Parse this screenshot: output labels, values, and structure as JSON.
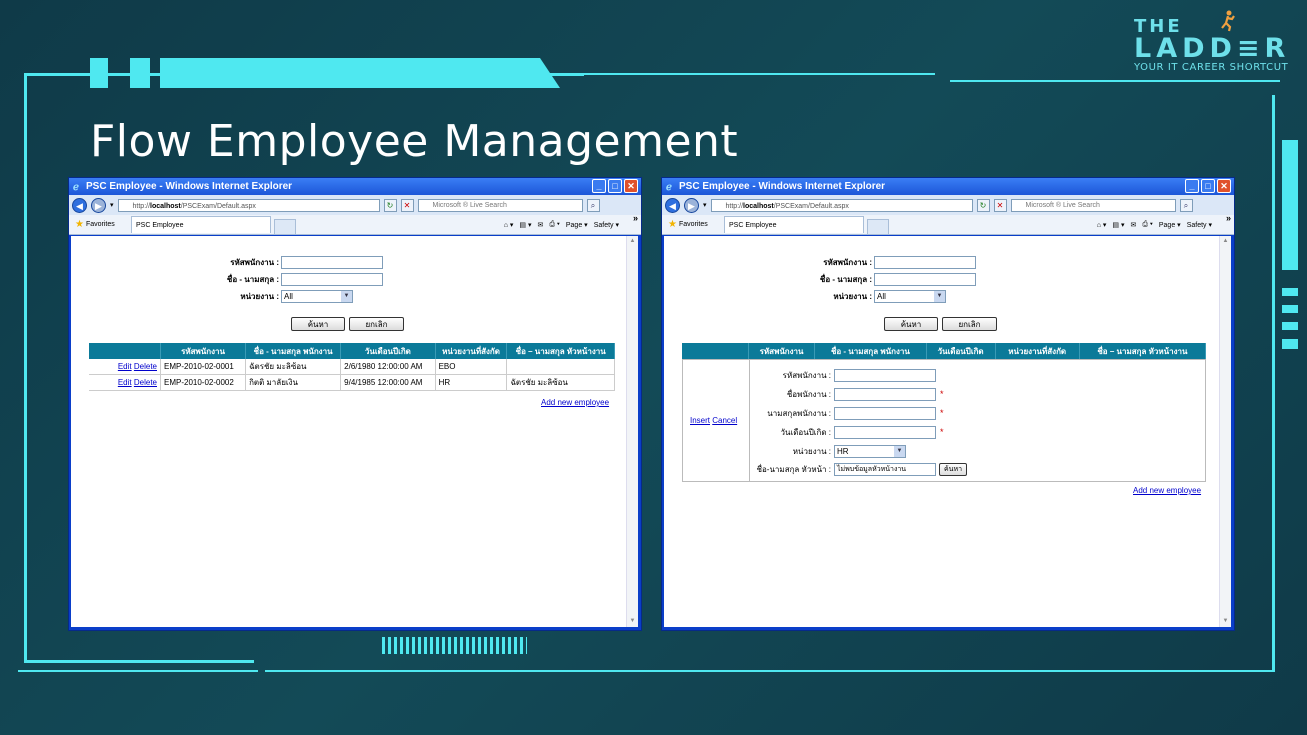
{
  "slide": {
    "title": "Flow Employee Management",
    "logo": {
      "the": "THE",
      "ladder": "LADD≡R",
      "tagline": "YOUR IT CAREER SHORTCUT"
    }
  },
  "browser": {
    "window_title": "PSC Employee - Windows Internet Explorer",
    "url_prefix": "http://",
    "url_host": "localhost",
    "url_path": "/PSCExam/Default.aspx",
    "search_placeholder": "Microsoft ® Live Search",
    "favorites_label": "Favorites",
    "tab_label": "PSC Employee",
    "page_menu": "Page ▾",
    "safety_menu": "Safety ▾"
  },
  "search_form": {
    "emp_id_label": "รหัสพนักงาน :",
    "name_label": "ชื่อ - นามสกุล :",
    "dept_label": "หน่วยงาน :",
    "dept_value": "All",
    "search_button": "ค้นหา",
    "cancel_button": "ยกเลิก"
  },
  "grid": {
    "headers": [
      "",
      "รหัสพนักงาน",
      "ชื่อ - นามสกุล พนักงาน",
      "วันเดือนปีเกิด",
      "หน่วยงานที่สังกัด",
      "ชื่อ – นามสกุล หัวหน้างาน"
    ],
    "edit_label": "Edit",
    "delete_label": "Delete",
    "rows": [
      {
        "id": "EMP-2010-02-0001",
        "name": "ฉัตรชัย มะลิซ้อน",
        "dob": "2/6/1980 12:00:00 AM",
        "dept": "EBO",
        "manager": ""
      },
      {
        "id": "EMP-2010-02-0002",
        "name": "กิตติ มาลัยเงิน",
        "dob": "9/4/1985 12:00:00 AM",
        "dept": "HR",
        "manager": "ฉัตรชัย มะลิซ้อน"
      }
    ],
    "add_new": "Add new employee"
  },
  "insert_form": {
    "insert_label": "Insert",
    "cancel_label": "Cancel",
    "fields": {
      "emp_id": "รหัสพนักงาน :",
      "first_name": "ชื่อพนักงาน :",
      "last_name": "นามสกุลพนักงาน :",
      "dob": "วันเดือนปีเกิด :",
      "dept": "หน่วยงาน :",
      "manager": "ชื่อ-นามสกุล หัวหน้า :"
    },
    "dept_value": "HR",
    "manager_value": "ไม่พบข้อมูลหัวหน้างาน",
    "manager_search": "ค้นหา",
    "required_mark": "*"
  },
  "colors": {
    "accent": "#4fe8f0",
    "bg": "#134a57",
    "grid_header": "#0b7a99",
    "link": "#0000cc"
  }
}
